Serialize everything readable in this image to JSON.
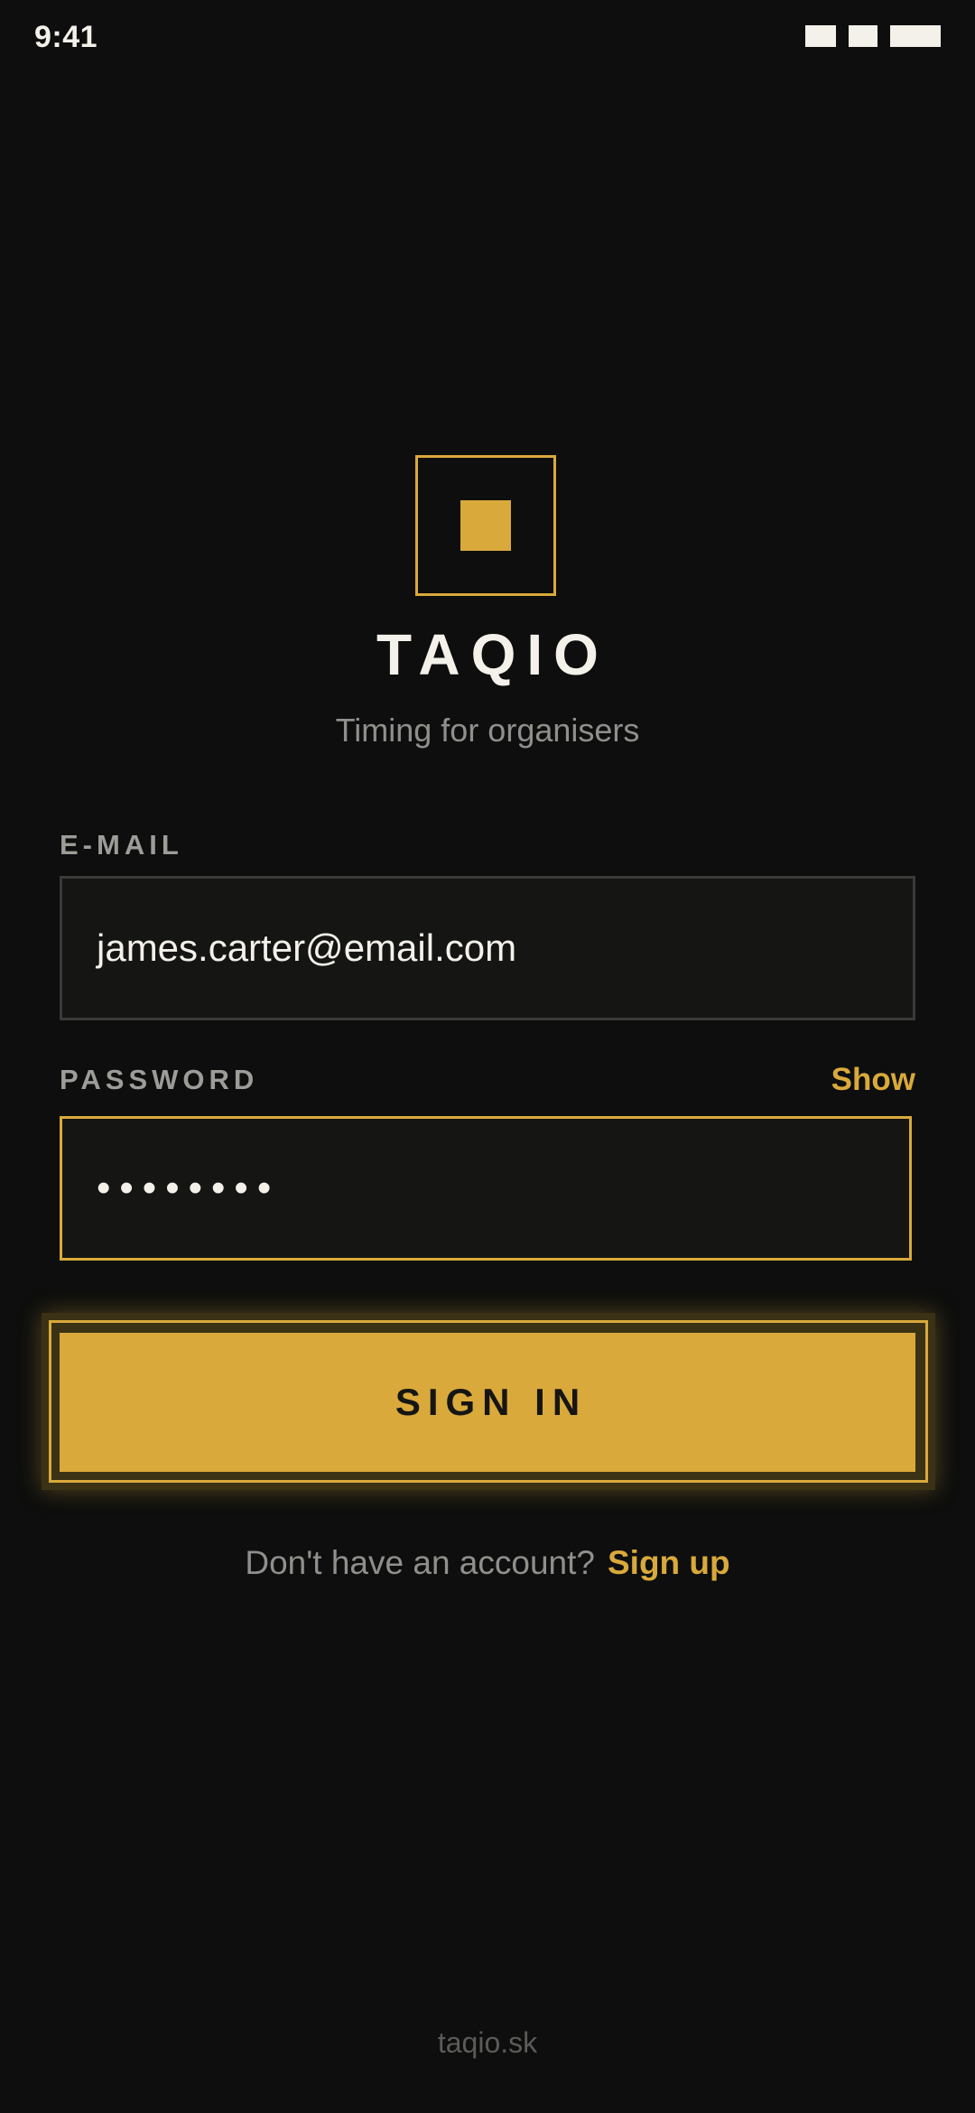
{
  "status_bar": {
    "time": "9:41",
    "icons": [
      "signal-icon",
      "wifi-icon",
      "battery-icon"
    ]
  },
  "brand": {
    "name": "TAQIO",
    "tagline": "Timing for organisers",
    "logo_icon": "square-logo-icon"
  },
  "form": {
    "email_label": "E-MAIL",
    "email_value": "james.carter@email.com",
    "password_label": "PASSWORD",
    "password_value": "••••••••",
    "show_label": "Show",
    "submit_label": "SIGN IN"
  },
  "signup": {
    "prompt": "Don't have an account?",
    "link_label": "Sign up"
  },
  "footer": {
    "text": "taqio.sk"
  },
  "colors": {
    "background": "#0d0e0d",
    "accent": "#d9a93b",
    "input_background": "#151614",
    "muted_text": "#8f908c"
  }
}
